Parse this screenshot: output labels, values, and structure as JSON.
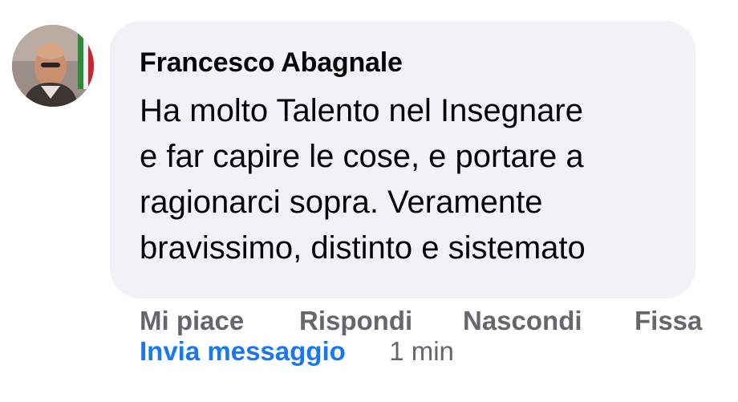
{
  "comment": {
    "author": "Francesco Abagnale",
    "text_lines": [
      "Ha molto Talento nel Insegnare",
      "e far capire le cose, e portare a",
      "ragionarci sopra. Veramente",
      "bravissimo, distinto e sistemato"
    ],
    "actions": {
      "like": "Mi piace",
      "reply": "Rispondi",
      "hide": "Nascondi",
      "pin": "Fissa"
    },
    "send_message": "Invia messaggio",
    "timestamp": "1 min"
  },
  "colors": {
    "bubble_background": "#f0f2f5",
    "action_text": "#65676b",
    "link_blue": "#1877f2",
    "primary_text": "#050505"
  }
}
